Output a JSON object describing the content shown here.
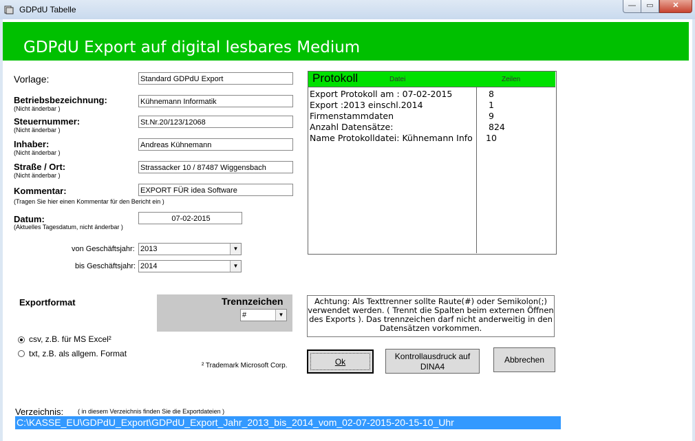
{
  "window": {
    "title": "GDPdU Tabelle",
    "min_glyph": "—",
    "max_glyph": "▭",
    "close_glyph": "✕"
  },
  "header": {
    "title": "GDPdU Export auf digital lesbares Medium"
  },
  "form": {
    "vorlage": {
      "label": "Vorlage:",
      "value": "Standard  GDPdU Export"
    },
    "betrieb": {
      "label": "Betriebsbezeichnung:",
      "note": "(Nicht änderbar )",
      "value": "Kühnemann Informatik"
    },
    "steuer": {
      "label": "Steuernummer:",
      "note": "(Nicht änderbar )",
      "value": "St.Nr.20/123/12068"
    },
    "inhaber": {
      "label": "Inhaber:",
      "note": "(Nicht änderbar )",
      "value": "Andreas Kühnemann"
    },
    "strasse": {
      "label": "Straße / Ort:",
      "note": "(Nicht änderbar )",
      "value": "Strassacker 10 / 87487  Wiggensbach"
    },
    "kommentar": {
      "label": "Kommentar:",
      "note": "(Tragen Sie hier einen Kommentar für den Bericht ein )",
      "value": "EXPORT FÜR idea Software"
    },
    "datum": {
      "label": "Datum:",
      "note": "(Aktuelles Tagesdatum, nicht änderbar )",
      "value": "07-02-2015"
    },
    "von": {
      "label": "von Geschäftsjahr:",
      "value": "2013"
    },
    "bis": {
      "label": "bis Geschäftsjahr:",
      "value": "2014"
    }
  },
  "protokoll": {
    "title": "Protokoll",
    "col_datei": "Datei",
    "col_zeilen": "Zeilen",
    "rows": [
      {
        "text": "Export Protokoll am : 07-02-2015",
        "zeilen": "8"
      },
      {
        "text": "Export :2013 einschl.2014",
        "zeilen": "1"
      },
      {
        "text": "Firmenstammdaten",
        "zeilen": "9"
      },
      {
        "text": "Anzahl Datensätze:",
        "zeilen": "824"
      },
      {
        "text": "Name Protokolldatei: Kühnemann Info",
        "zeilen": "10"
      }
    ]
  },
  "exportformat": {
    "title": "Exportformat",
    "trenn_label": "Trennzeichen",
    "trenn_value": "#",
    "option_csv": "csv, z.B. für MS Excel²",
    "option_txt": "txt, z.B. als allgem. Format",
    "trademark": "² Trademark Microsoft Corp."
  },
  "notice": "Achtung: Als Texttrenner sollte Raute(#) oder Semikolon(;) verwendet werden. ( Trennt die Spalten beim externen Öffnen des Exports ). Das trennzeichen darf nicht anderweitig in den Datensätzen vorkommen.",
  "buttons": {
    "ok": "Ok",
    "print_line1": "Kontrollausdruck  auf",
    "print_line2": "DINA4",
    "cancel": "Abbrechen"
  },
  "verzeichnis": {
    "label": "Verzeichnis:",
    "note": "( in diesem Verzeichnis finden Sie die Exportdateien )",
    "path": "C:\\KASSE_EU\\GDPdU_Export\\GDPdU_Export_Jahr_2013_bis_2014_vom_02-07-2015-20-15-10_Uhr"
  },
  "colors": {
    "header_green": "#00c000",
    "protokoll_green": "#00e000",
    "selection_blue": "#3399ff"
  }
}
